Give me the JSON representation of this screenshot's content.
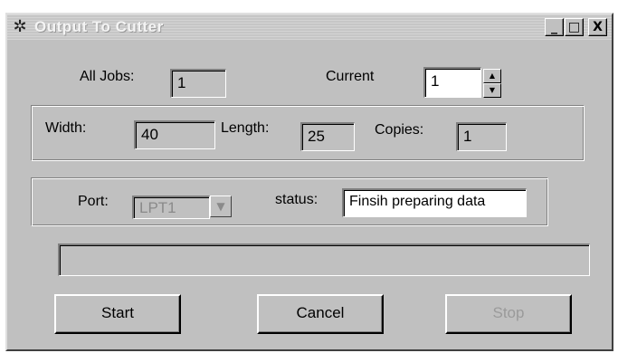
{
  "window": {
    "title": "Output To Cutter",
    "icon": "cutter-app-icon",
    "minimize_label": "_",
    "maximize_label": "□",
    "close_label": "X"
  },
  "jobs": {
    "all_jobs_label": "All Jobs:",
    "all_jobs_value": "1",
    "current_label": "Current",
    "current_value": "1",
    "spin_up": "▲",
    "spin_down": "▼"
  },
  "dimensions": {
    "width_label": "Width:",
    "width_value": "40",
    "length_label": "Length:",
    "length_value": "25",
    "copies_label": "Copies:",
    "copies_value": "1"
  },
  "port": {
    "port_label": "Port:",
    "port_value": "LPT1",
    "status_label": "status:",
    "status_value": "Finsih preparing data"
  },
  "progress": {
    "value": 0
  },
  "buttons": {
    "start": "Start",
    "cancel": "Cancel",
    "stop": "Stop"
  }
}
